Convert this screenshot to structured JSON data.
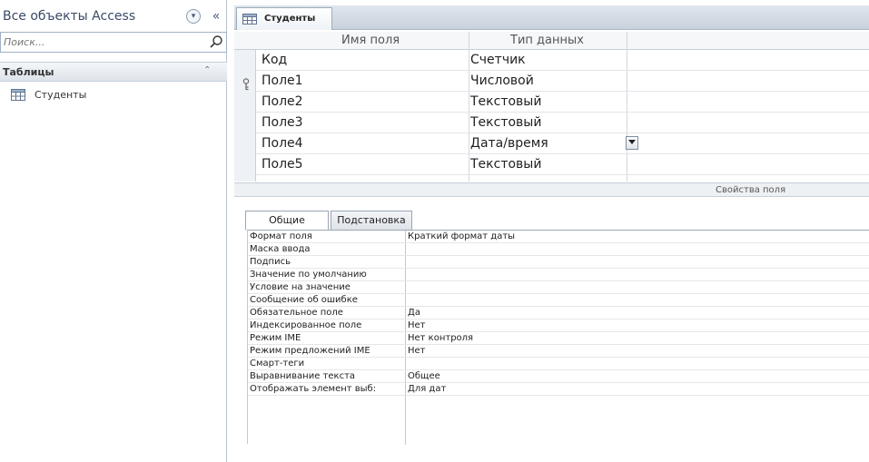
{
  "nav": {
    "title": "Все объекты Access",
    "search": {
      "placeholder": "Поиск..."
    },
    "group": {
      "label": "Таблицы"
    },
    "items": [
      {
        "label": "Студенты"
      }
    ]
  },
  "document": {
    "tab": {
      "label": "Студенты"
    },
    "grid": {
      "headers": {
        "name": "Имя поля",
        "type": "Тип данных"
      },
      "rows": [
        {
          "name": "Код",
          "type": "Счетчик"
        },
        {
          "name": "Поле1",
          "type": "Числовой"
        },
        {
          "name": "Поле2",
          "type": "Текстовый"
        },
        {
          "name": "Поле3",
          "type": "Текстовый"
        },
        {
          "name": "Поле4",
          "type": "Дата/время"
        },
        {
          "name": "Поле5",
          "type": "Текстовый"
        }
      ]
    },
    "field_properties_label": "Свойства поля",
    "property_tabs": {
      "general": "Общие",
      "lookup": "Подстановка"
    },
    "properties": [
      {
        "label": "Формат поля",
        "value": "Краткий формат даты"
      },
      {
        "label": "Маска ввода",
        "value": ""
      },
      {
        "label": "Подпись",
        "value": ""
      },
      {
        "label": "Значение по умолчанию",
        "value": ""
      },
      {
        "label": "Условие на значение",
        "value": ""
      },
      {
        "label": "Сообщение об ошибке",
        "value": ""
      },
      {
        "label": "Обязательное поле",
        "value": "Да"
      },
      {
        "label": "Индексированное поле",
        "value": "Нет"
      },
      {
        "label": "Режим IME",
        "value": "Нет контроля"
      },
      {
        "label": "Режим предложений IME",
        "value": "Нет"
      },
      {
        "label": "Смарт-теги",
        "value": ""
      },
      {
        "label": "Выравнивание текста",
        "value": "Общее"
      },
      {
        "label": "Отображать элемент выб:",
        "value": "Для дат"
      }
    ]
  },
  "icons": {
    "nav_menu": "chevron-down-circle-icon",
    "nav_collapse": "double-chevron-left-icon",
    "search": "search-icon",
    "group_toggle": "double-chevron-up-icon",
    "table": "table-icon",
    "primary_key": "key-icon",
    "dropdown": "chevron-down-icon"
  },
  "colors": {
    "accent": "#3a4a68",
    "header_bg": "#dfe5ec"
  }
}
